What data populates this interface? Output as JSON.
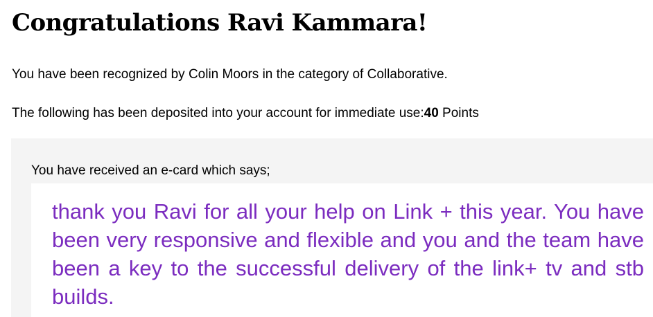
{
  "heading": "Congratulations Ravi Kammara!",
  "recognition": {
    "text": "You have been recognized by Colin Moors in the category of Collaborative."
  },
  "deposit": {
    "prefix": "The following has been deposited into your account for immediate use:",
    "points_value": "40",
    "points_unit": " Points"
  },
  "ecard": {
    "intro": "You have received an e-card which says;",
    "message": "thank you Ravi for all your help on Link + this year. You have been very responsive and flexible and you and the team have been a key to the successful delivery of the link+ tv and stb builds.",
    "message_color": "#7b2cbf",
    "panel_color": "#f4f4f4"
  }
}
